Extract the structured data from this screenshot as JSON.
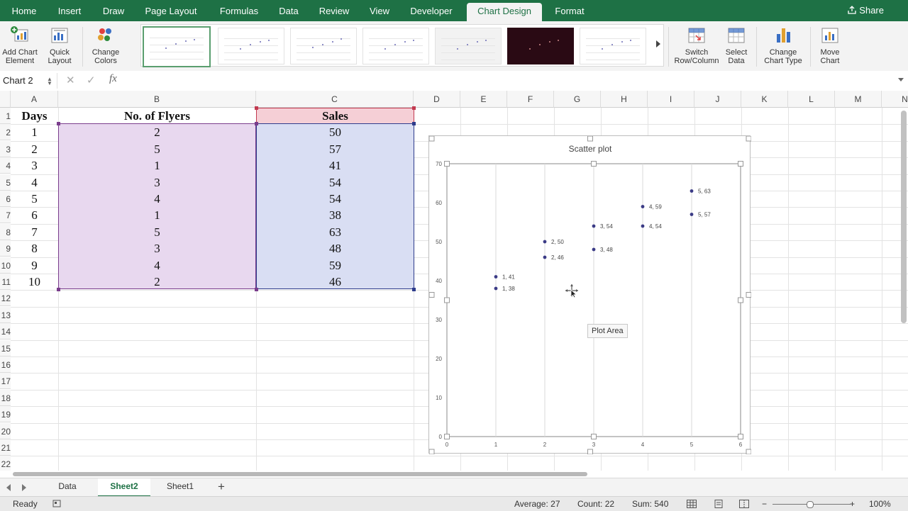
{
  "ribbon_tabs": [
    "Home",
    "Insert",
    "Draw",
    "Page Layout",
    "Formulas",
    "Data",
    "Review",
    "View",
    "Developer",
    "Chart Design",
    "Format"
  ],
  "share_label": "Share",
  "ribbon": {
    "add_chart_element": "Add Chart\nElement",
    "quick_layout": "Quick\nLayout",
    "change_colors": "Change\nColors",
    "switch_row_col": "Switch\nRow/Column",
    "select_data": "Select\nData",
    "change_chart_type": "Change\nChart Type",
    "move_chart": "Move\nChart"
  },
  "formula_bar": {
    "name_box": "Chart 2",
    "fx": "fx",
    "cancel": "✕",
    "enter": "✓"
  },
  "columns": [
    "A",
    "B",
    "C",
    "D",
    "E",
    "F",
    "G",
    "H",
    "I",
    "J",
    "K",
    "L",
    "M",
    "N"
  ],
  "rows": [
    "1",
    "2",
    "3",
    "4",
    "5",
    "6",
    "7",
    "8",
    "9",
    "10",
    "11",
    "12",
    "13",
    "14",
    "15",
    "16",
    "17",
    "18",
    "19",
    "20",
    "21",
    "22"
  ],
  "table": {
    "headers": [
      "Days",
      "No. of Flyers",
      "Sales"
    ],
    "data": [
      [
        "1",
        "2",
        "50"
      ],
      [
        "2",
        "5",
        "57"
      ],
      [
        "3",
        "1",
        "41"
      ],
      [
        "4",
        "3",
        "54"
      ],
      [
        "5",
        "4",
        "54"
      ],
      [
        "6",
        "1",
        "38"
      ],
      [
        "7",
        "5",
        "63"
      ],
      [
        "8",
        "3",
        "48"
      ],
      [
        "9",
        "4",
        "59"
      ],
      [
        "10",
        "2",
        "46"
      ]
    ]
  },
  "chart_data": {
    "type": "scatter",
    "title": "Scatter plot",
    "xlabel": "",
    "ylabel": "",
    "xlim": [
      0,
      6
    ],
    "ylim": [
      0,
      70
    ],
    "x_ticks": [
      0,
      1,
      2,
      3,
      4,
      5,
      6
    ],
    "y_ticks": [
      0,
      10,
      20,
      30,
      40,
      50,
      60,
      70
    ],
    "grid": "vertical",
    "legend": "none",
    "point_color": "#3b3b86",
    "points": [
      {
        "x": 2,
        "y": 50,
        "label": "2, 50"
      },
      {
        "x": 5,
        "y": 57,
        "label": "5, 57"
      },
      {
        "x": 1,
        "y": 41,
        "label": "1, 41"
      },
      {
        "x": 3,
        "y": 54,
        "label": "3, 54"
      },
      {
        "x": 4,
        "y": 54,
        "label": "4, 54"
      },
      {
        "x": 1,
        "y": 38,
        "label": "1, 38"
      },
      {
        "x": 5,
        "y": 63,
        "label": "5, 63"
      },
      {
        "x": 3,
        "y": 48,
        "label": "3, 48"
      },
      {
        "x": 4,
        "y": 59,
        "label": "4, 59"
      },
      {
        "x": 2,
        "y": 46,
        "label": "2, 46"
      }
    ]
  },
  "tooltip": "Plot Area",
  "sheet_tabs": [
    "Data",
    "Sheet2",
    "Sheet1"
  ],
  "active_sheet": "Sheet2",
  "add_sheet": "+",
  "status": {
    "mode": "Ready",
    "average": "Average: 27",
    "count": "Count: 22",
    "sum": "Sum: 540",
    "zoom": "100%",
    "zoom_minus": "−",
    "zoom_plus": "+"
  },
  "colors": {
    "ribbon": "#1e7145",
    "flyers_fill": "#e8d8ef",
    "sales_fill": "#d9def3",
    "sales_header_fill": "#f5cfd6"
  }
}
